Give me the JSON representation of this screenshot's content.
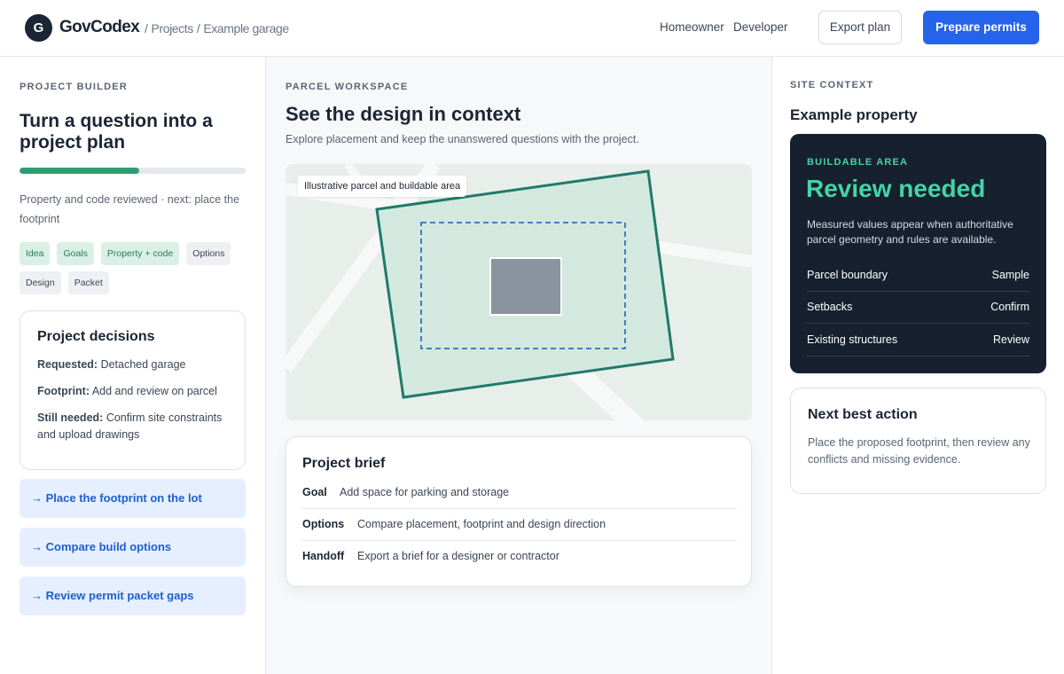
{
  "header": {
    "logo_letter": "G",
    "brand": "GovCodex",
    "breadcrumb": [
      "Projects",
      "Example garage"
    ],
    "breadcrumb_sep": "/",
    "nav": [
      "Homeowner",
      "Developer"
    ],
    "export_label": "Export plan",
    "primary_label": "Prepare permits"
  },
  "builder": {
    "eyebrow": "PROJECT BUILDER",
    "title": "Turn a question into a project plan",
    "progress": 0.53,
    "progress_text": "Property and code reviewed · next: place the footprint",
    "stages": [
      {
        "label": "Idea",
        "done": true
      },
      {
        "label": "Goals",
        "done": true
      },
      {
        "label": "Property + code",
        "done": true
      },
      {
        "label": "Options",
        "done": false
      },
      {
        "label": "Design",
        "done": false
      },
      {
        "label": "Packet",
        "done": false
      }
    ],
    "decisions": {
      "title": "Project decisions",
      "rows": [
        {
          "label": "Requested:",
          "value": "Detached garage"
        },
        {
          "label": "Footprint:",
          "value": "Add and review on parcel"
        },
        {
          "label": "Still needed:",
          "value": "Confirm site constraints and upload drawings"
        }
      ]
    },
    "actions": [
      "→ Place the footprint on the lot",
      "→ Compare build options",
      "→ Review permit packet gaps"
    ]
  },
  "workspace": {
    "eyebrow": "PARCEL WORKSPACE",
    "title": "See the design in context",
    "subtitle": "Explore placement and keep the unanswered questions with the project.",
    "map_tag": "Illustrative parcel and buildable area",
    "colors": {
      "parcel": "#1f7a6b",
      "buildable": "#2f6fc0",
      "structure": "#8a949f"
    }
  },
  "brief": {
    "title": "Project brief",
    "rows": [
      {
        "key": "Goal",
        "value": "Add space for parking and storage"
      },
      {
        "key": "Options",
        "value": "Compare placement, footprint and design direction"
      },
      {
        "key": "Handoff",
        "value": "Export a brief for a designer or contractor"
      }
    ]
  },
  "site": {
    "eyebrow": "SITE CONTEXT",
    "title": "Example property",
    "card": {
      "eyebrow": "BUILDABLE AREA",
      "status": "Review needed",
      "note": "Measured values appear when authoritative parcel geometry and rules are available.",
      "rows": [
        {
          "label": "Parcel boundary",
          "value": "Sample"
        },
        {
          "label": "Setbacks",
          "value": "Confirm"
        },
        {
          "label": "Existing structures",
          "value": "Review"
        }
      ]
    },
    "next": {
      "title": "Next best action",
      "body": "Place the proposed footprint, then review any conflicts and missing evidence."
    }
  }
}
